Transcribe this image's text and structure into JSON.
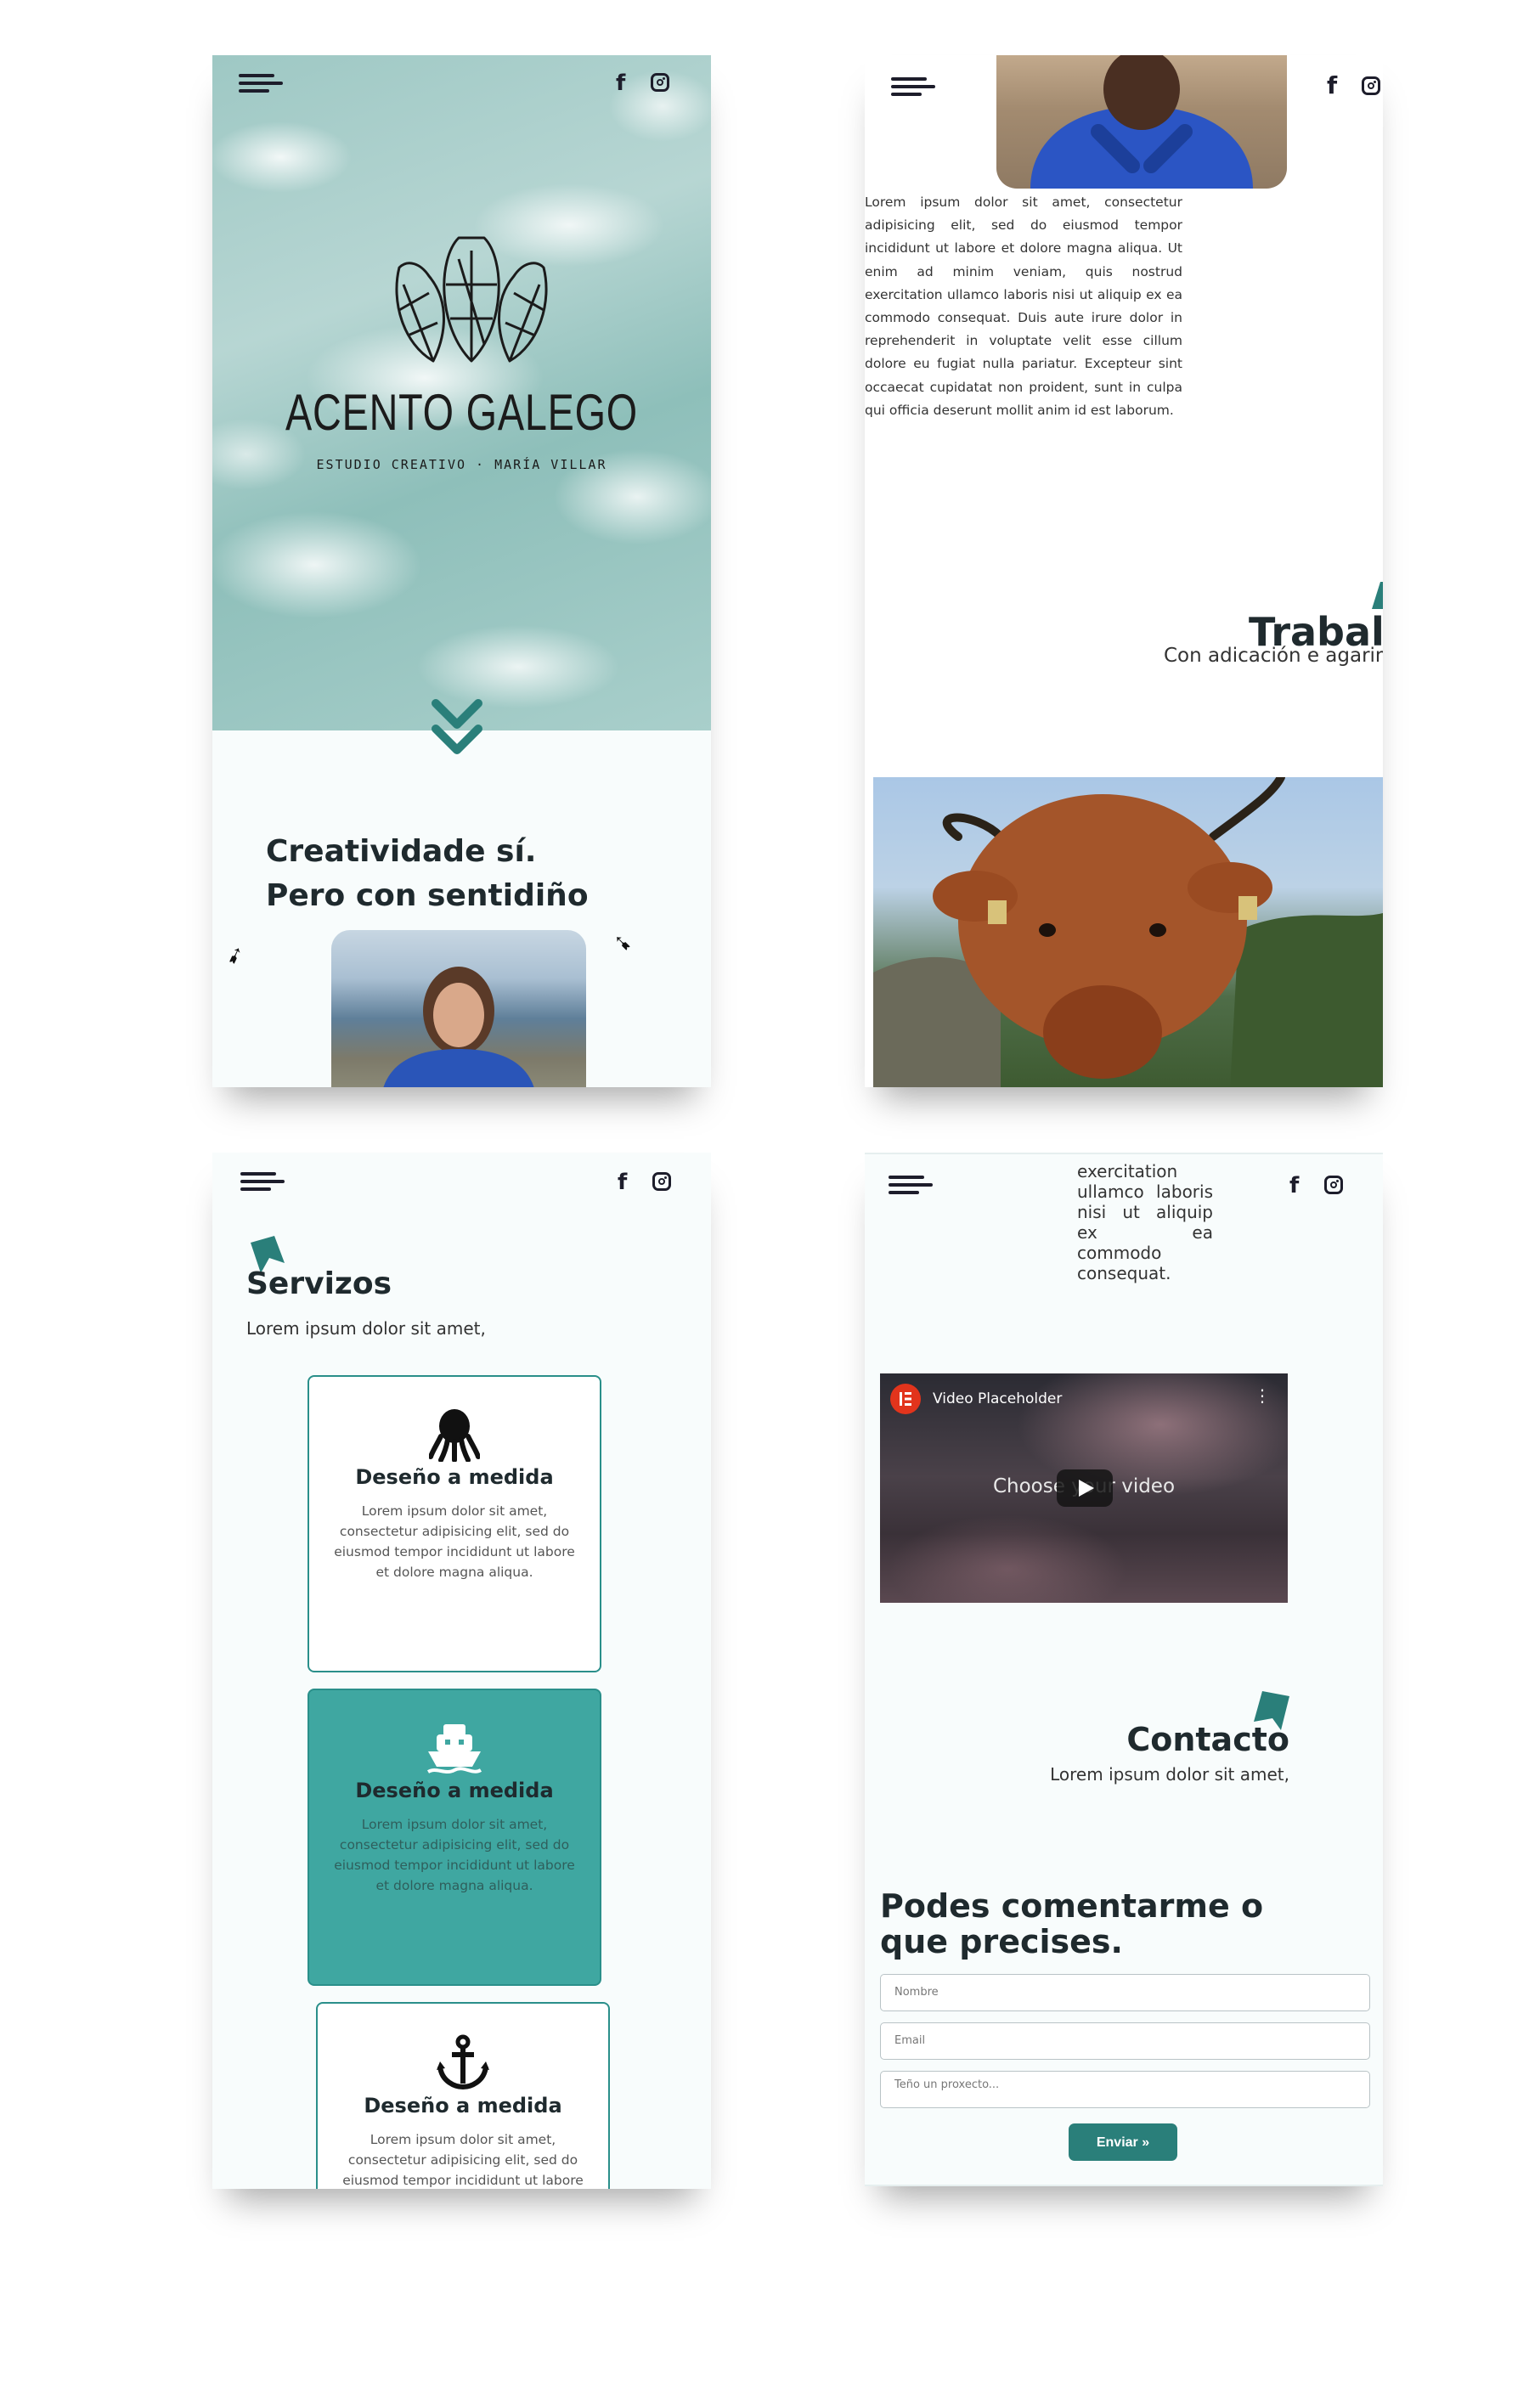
{
  "social": {
    "facebook_glyph": "f"
  },
  "screen1": {
    "brand_name": "ACENTO GALEGO",
    "brand_tagline": "ESTUDIO CREATIVO · MARÍA VILLAR",
    "headline_line1": "Creatividade sí.",
    "headline_line2": "Pero con sentidiño"
  },
  "screen2": {
    "body_text": "Lorem ipsum dolor sit amet, consectetur adipisicing elit, sed do eiusmod tempor incididunt ut labore et dolore magna aliqua. Ut enim ad minim veniam, quis nostrud exercitation ullamco laboris nisi ut aliquip ex ea commodo consequat. Duis aute irure dolor in reprehenderit in voluptate velit esse cillum dolore eu fugiat nulla pariatur. Excepteur sint occaecat cupidatat non proident, sunt in culpa qui officia deserunt mollit anim id est laborum.",
    "section_title": "Traballo",
    "section_subtitle": "Con adicación e agarimo"
  },
  "screen3": {
    "section_title": "Servizos",
    "section_subtitle": "Lorem ipsum dolor sit amet,",
    "cards": [
      {
        "icon": "octopus-icon",
        "title": "Deseño a medida",
        "text": "Lorem ipsum dolor sit amet, consectetur adipisicing elit, sed do eiusmod tempor incididunt ut labore et dolore magna aliqua."
      },
      {
        "icon": "boat-icon",
        "title": "Deseño a medida",
        "text": "Lorem ipsum dolor sit amet, consectetur adipisicing elit, sed do eiusmod tempor incididunt ut labore et dolore magna aliqua."
      },
      {
        "icon": "anchor-icon",
        "title": "Deseño a medida",
        "text": "Lorem ipsum dolor sit amet, consectetur adipisicing elit, sed do eiusmod tempor incididunt ut labore et dolore magna aliqua."
      }
    ],
    "accent_color": "#3fa7a1"
  },
  "screen4": {
    "top_text": "exercitation ullamco laboris nisi ut aliquip ex ea commodo consequat.",
    "video": {
      "title": "Video Placeholder",
      "overlay_text": "Choose your video"
    },
    "section_title": "Contacto",
    "section_subtitle": "Lorem ipsum dolor sit amet,",
    "form_heading": "Podes comentarme o que precises.",
    "fields": {
      "name_placeholder": "Nombre",
      "email_placeholder": "Email",
      "message_placeholder": "Teño un proxecto..."
    },
    "submit_label": "Enviar »",
    "button_color": "#2a7f7a"
  }
}
